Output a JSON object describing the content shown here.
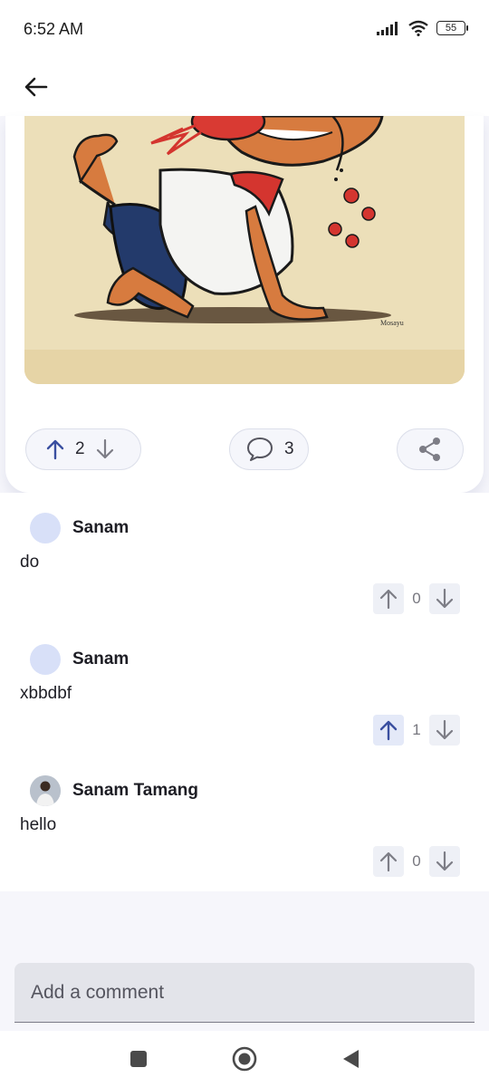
{
  "status_bar": {
    "time": "6:52 AM",
    "battery": "55"
  },
  "post": {
    "votes": "2",
    "comments_count": "3",
    "image_signature": "Mosayu"
  },
  "comments": [
    {
      "author": "Sanam",
      "text": "do",
      "votes": "0",
      "upvoted": false
    },
    {
      "author": "Sanam",
      "text": "xbbdbf",
      "votes": "1",
      "upvoted": true
    },
    {
      "author": "Sanam Tamang",
      "text": "hello",
      "votes": "0",
      "upvoted": false
    }
  ],
  "comment_input": {
    "placeholder": "Add a comment"
  },
  "colors": {
    "accent": "#3a4fa0",
    "icon_grey": "#7d7d86"
  }
}
